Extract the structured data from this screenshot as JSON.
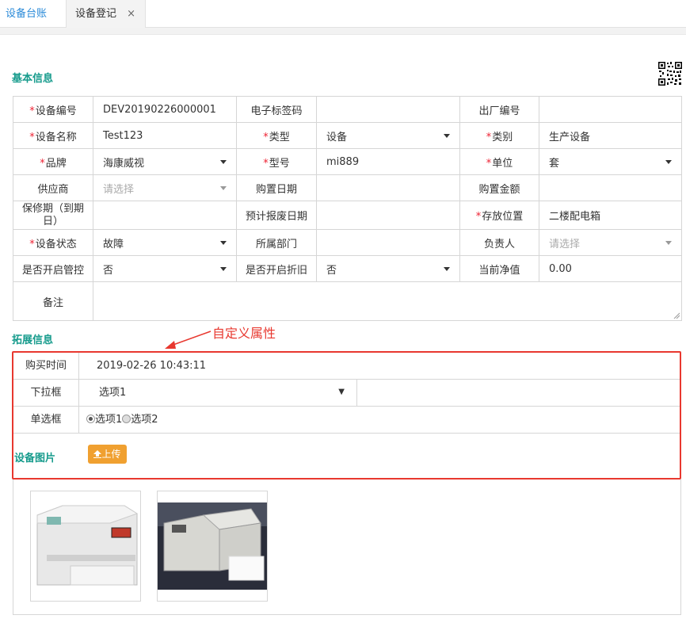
{
  "tabs": [
    {
      "label": "设备台账"
    },
    {
      "label": "设备登记",
      "close": "×"
    }
  ],
  "sections": {
    "basic": "基本信息",
    "extended": "拓展信息"
  },
  "basic": {
    "asset_no_label": "设备编号",
    "asset_no": "DEV20190226000001",
    "rfid_label": "电子标签码",
    "rfid": "",
    "factory_no_label": "出厂编号",
    "factory_no": "",
    "name_label": "设备名称",
    "name": "Test123",
    "type_label": "类型",
    "type": "设备",
    "category_label": "类别",
    "category": "生产设备",
    "brand_label": "品牌",
    "brand": "海康威视",
    "model_label": "型号",
    "model": "mi889",
    "unit_label": "单位",
    "unit": "套",
    "supplier_label": "供应商",
    "supplier_placeholder": "请选择",
    "purchase_date_label": "购置日期",
    "purchase_date": "",
    "purchase_amount_label": "购置金额",
    "purchase_amount": "",
    "warranty_label": "保修期（到期日）",
    "warranty": "",
    "scrap_date_label": "预计报废日期",
    "scrap_date": "",
    "location_label": "存放位置",
    "location": "二楼配电箱",
    "status_label": "设备状态",
    "status": "故障",
    "department_label": "所属部门",
    "department": "",
    "owner_label": "负责人",
    "owner_placeholder": "请选择",
    "control_label": "是否开启管控",
    "control": "否",
    "depreciation_label": "是否开启折旧",
    "depreciation": "否",
    "net_value_label": "当前净值",
    "net_value": "0.00",
    "remark_label": "备注",
    "remark": ""
  },
  "annotation": "自定义属性",
  "extended": {
    "buy_time_label": "购买时间",
    "buy_time": "2019-02-26 10:43:11",
    "dropdown_label": "下拉框",
    "dropdown_value": "选项1",
    "radio_label": "单选框",
    "radio_options": [
      "选项1",
      "选项2"
    ],
    "image_label": "设备图片",
    "upload_label": "上传"
  },
  "colors": {
    "accent": "#169b8c",
    "tab_active_text": "#2a8ad8",
    "annotation_red": "#e8382f",
    "upload_button": "#f0a030",
    "required": "#e23333"
  },
  "icons": [
    "close-icon",
    "qr-code-icon",
    "chevron-down-icon",
    "upload-icon",
    "radio-icon"
  ]
}
